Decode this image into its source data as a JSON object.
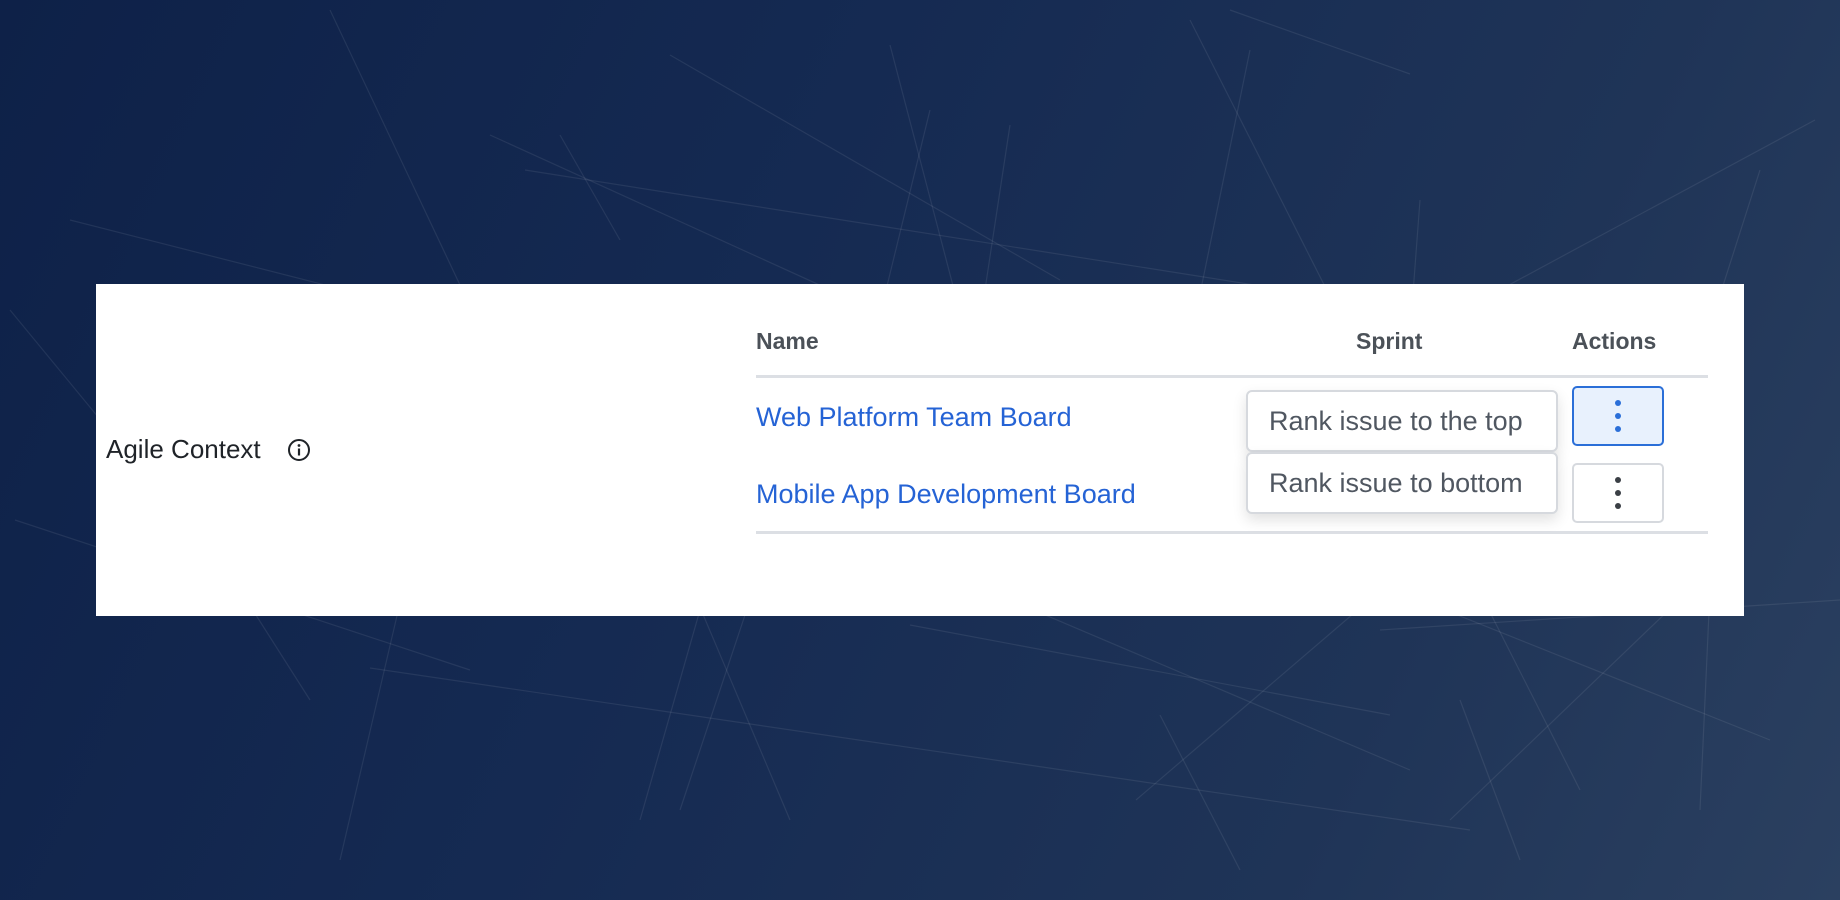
{
  "field": {
    "label": "Agile Context",
    "info_icon": "info-icon"
  },
  "table": {
    "headers": {
      "name": "Name",
      "sprint": "Sprint",
      "actions": "Actions"
    },
    "rows": [
      {
        "name": "Web Platform Team Board",
        "actions_icon": "more-vertical-icon",
        "actions_active": true
      },
      {
        "name": "Mobile App Development Board",
        "actions_icon": "more-vertical-icon",
        "actions_active": false
      }
    ]
  },
  "menu": {
    "items": [
      {
        "label": "Rank issue to the top"
      },
      {
        "label": "Rank issue to bottom"
      }
    ]
  },
  "colors": {
    "link": "#2563d5",
    "accent": "#2b6fd8",
    "active_bg": "#e8f1fd",
    "background_start": "#0e2148",
    "background_end": "#2b4060"
  }
}
